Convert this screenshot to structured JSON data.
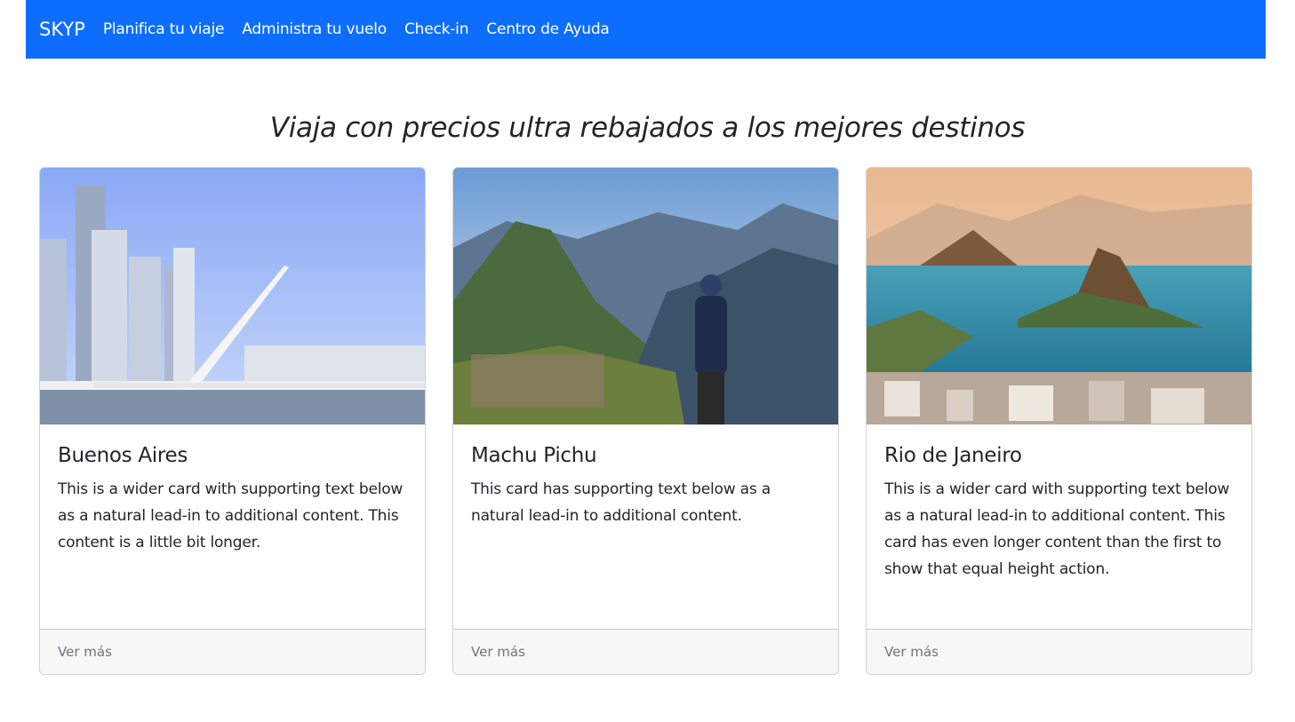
{
  "navbar": {
    "brand": "SKYP",
    "links": [
      "Planifica tu viaje",
      "Administra tu vuelo",
      "Check-in",
      "Centro de Ayuda"
    ],
    "background": "#0d6efd"
  },
  "headline": "Viaja con precios ultra rebajados a los mejores destinos",
  "cards": [
    {
      "title": "Buenos Aires",
      "text": "This is a wider card with supporting text below as a natural lead-in to additional content. This content is a little bit longer.",
      "footer": "Ver más",
      "image": "buenos-aires-skyline-bridge"
    },
    {
      "title": "Machu Pichu",
      "text": "This card has supporting text below as a natural lead-in to additional content.",
      "footer": "Ver más",
      "image": "machu-picchu-hiker"
    },
    {
      "title": "Rio de Janeiro",
      "text": "This is a wider card with supporting text below as a natural lead-in to additional content. This card has even longer content than the first to show that equal height action.",
      "footer": "Ver más",
      "image": "rio-de-janeiro-bay"
    }
  ]
}
